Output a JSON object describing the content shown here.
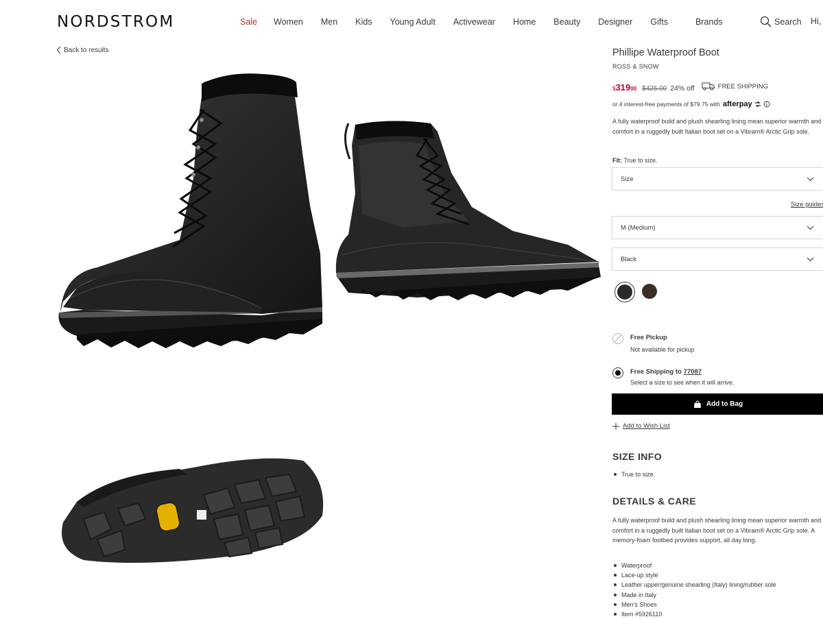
{
  "header": {
    "logo": "NORDSTROM",
    "nav": [
      "Sale",
      "Women",
      "Men",
      "Kids",
      "Young Adult",
      "Activewear",
      "Home",
      "Beauty",
      "Designer",
      "Gifts",
      "Brands"
    ],
    "search_label": "Search",
    "greeting": "Hi,"
  },
  "back_link": "Back to results",
  "product": {
    "title": "Phillipe Waterproof Boot",
    "brand": "ROSS & SNOW",
    "price_currency": "$",
    "price_main": "319",
    "price_cents": "00",
    "price_original": "$425.00",
    "discount": "24% off",
    "shipping_badge": "FREE SHIPPING",
    "afterpay_text": "or 4 interest-free payments of $79.75 with",
    "afterpay_brand": "afterpay",
    "description": "A fully waterproof build and plush shearling lining mean superior warmth and comfort in a ruggedly built Italian boot set on a Vibram® Arctic Grip sole.",
    "fit_label": "Fit:",
    "fit_value": "True to size.",
    "size_select": "Size",
    "size_guides": "Size guides",
    "width_select": "M (Medium)",
    "color_select": "Black",
    "swatches": [
      {
        "name": "Black",
        "color": "#2a2a2a"
      },
      {
        "name": "Brown",
        "color": "#3b2e26"
      }
    ],
    "pickup_title": "Free Pickup",
    "pickup_sub": "Not available for pickup",
    "shipping_title": "Free Shipping to",
    "shipping_zip": "77087",
    "shipping_sub": "Select a size to see when it will arrive.",
    "add_to_bag": "Add to Bag",
    "add_to_wishlist": "Add to Wish List"
  },
  "size_info": {
    "heading": "SIZE INFO",
    "items": [
      "True to size."
    ]
  },
  "details": {
    "heading": "DETAILS & CARE",
    "description": "A fully waterproof build and plush shearling lining mean superior warmth and comfort in a ruggedly built Italian boot set on a Vibram® Arctic Grip sole. A memory-foam footbed provides support, all day long.",
    "items": [
      "Waterproof",
      "Lace-up style",
      "Leather upper/genuine shearling (Italy) lining/rubber sole",
      "Made in Italy",
      "Men's Shoes",
      "Item #5926110"
    ]
  },
  "colors": {
    "sale": "#a2381c",
    "price": "#c0012a",
    "button_bg": "#000000"
  }
}
